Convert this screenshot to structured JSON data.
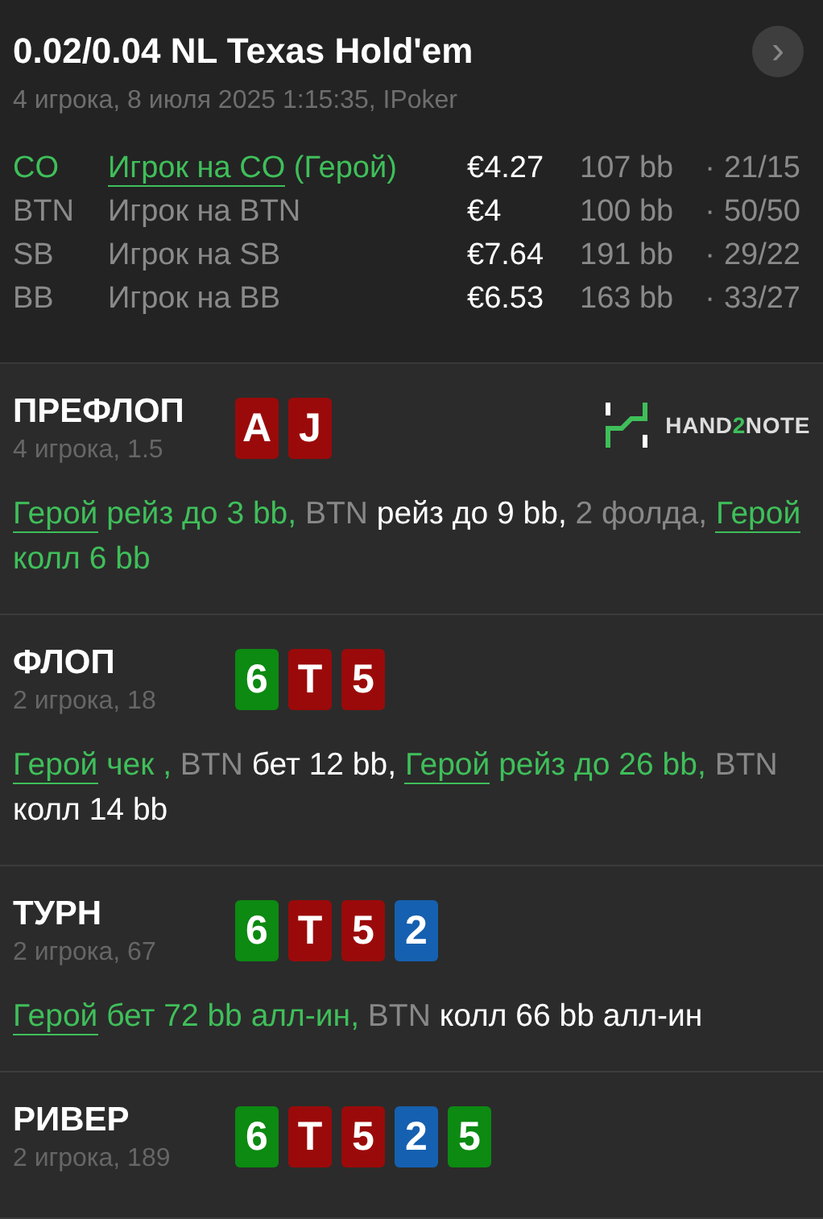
{
  "header": {
    "title": "0.02/0.04 NL Texas Hold'em",
    "subtitle": "4 игрока, 8 июля 2025 1:15:35, IPoker",
    "next_button": "›"
  },
  "players": [
    {
      "position": "CO",
      "name": "Игрок на CO",
      "note": "(Герой)",
      "hero": true,
      "stack": "€4.27",
      "bb": "107 bb",
      "dot": "·",
      "stats": "21/15"
    },
    {
      "position": "BTN",
      "name": "Игрок на BTN",
      "hero": false,
      "stack": "€4",
      "bb": "100 bb",
      "dot": "·",
      "stats": "50/50"
    },
    {
      "position": "SB",
      "name": "Игрок на SB",
      "hero": false,
      "stack": "€7.64",
      "bb": "191 bb",
      "dot": "·",
      "stats": "29/22"
    },
    {
      "position": "BB",
      "name": "Игрок на BB",
      "hero": false,
      "stack": "€6.53",
      "bb": "163 bb",
      "dot": "·",
      "stats": "33/27"
    }
  ],
  "streets": [
    {
      "title": "ПРЕФЛОП",
      "subtitle": "4 игрока, 1.5",
      "logo": [
        "HAND",
        "2",
        "NOTE"
      ],
      "cards": [
        {
          "rank": "A",
          "color": "#9b0a0a"
        },
        {
          "rank": "J",
          "color": "#9b0a0a"
        }
      ],
      "actions": [
        {
          "kind": "hero-link",
          "text": "Герой"
        },
        {
          "kind": "hero",
          "text": "рейз до 3 bb,"
        },
        {
          "kind": "player",
          "text": "BTN"
        },
        {
          "kind": "action",
          "text": "рейз до 9 bb,"
        },
        {
          "kind": "muted",
          "text": "2 фолда,"
        },
        {
          "kind": "hero-link",
          "text": "Герой"
        },
        {
          "kind": "hero",
          "text": "колл 6 bb"
        }
      ]
    },
    {
      "title": "ФЛОП",
      "subtitle": "2 игрока, 18",
      "cards": [
        {
          "rank": "6",
          "color": "#0c8a12"
        },
        {
          "rank": "T",
          "color": "#9b0a0a"
        },
        {
          "rank": "5",
          "color": "#9b0a0a"
        }
      ],
      "actions": [
        {
          "kind": "hero-link",
          "text": "Герой"
        },
        {
          "kind": "hero",
          "text": "чек ,"
        },
        {
          "kind": "player",
          "text": "BTN"
        },
        {
          "kind": "action",
          "text": "бет 12 bb,"
        },
        {
          "kind": "hero-link",
          "text": "Герой"
        },
        {
          "kind": "hero",
          "text": "рейз до 26 bb,"
        },
        {
          "kind": "player",
          "text": "BTN"
        },
        {
          "kind": "action",
          "text": "колл 14 bb"
        }
      ]
    },
    {
      "title": "ТУРН",
      "subtitle": "2 игрока, 67",
      "cards": [
        {
          "rank": "6",
          "color": "#0c8a12"
        },
        {
          "rank": "T",
          "color": "#9b0a0a"
        },
        {
          "rank": "5",
          "color": "#9b0a0a"
        },
        {
          "rank": "2",
          "color": "#1560b0"
        }
      ],
      "actions": [
        {
          "kind": "hero-link",
          "text": "Герой"
        },
        {
          "kind": "hero",
          "text": "бет 72 bb алл-ин,"
        },
        {
          "kind": "player",
          "text": "BTN"
        },
        {
          "kind": "action",
          "text": "колл 66 bb алл-ин"
        }
      ]
    },
    {
      "title": "РИВЕР",
      "subtitle": "2 игрока, 189",
      "cards": [
        {
          "rank": "6",
          "color": "#0c8a12"
        },
        {
          "rank": "T",
          "color": "#9b0a0a"
        },
        {
          "rank": "5",
          "color": "#9b0a0a"
        },
        {
          "rank": "2",
          "color": "#1560b0"
        },
        {
          "rank": "5",
          "color": "#0c8a12"
        }
      ]
    }
  ]
}
